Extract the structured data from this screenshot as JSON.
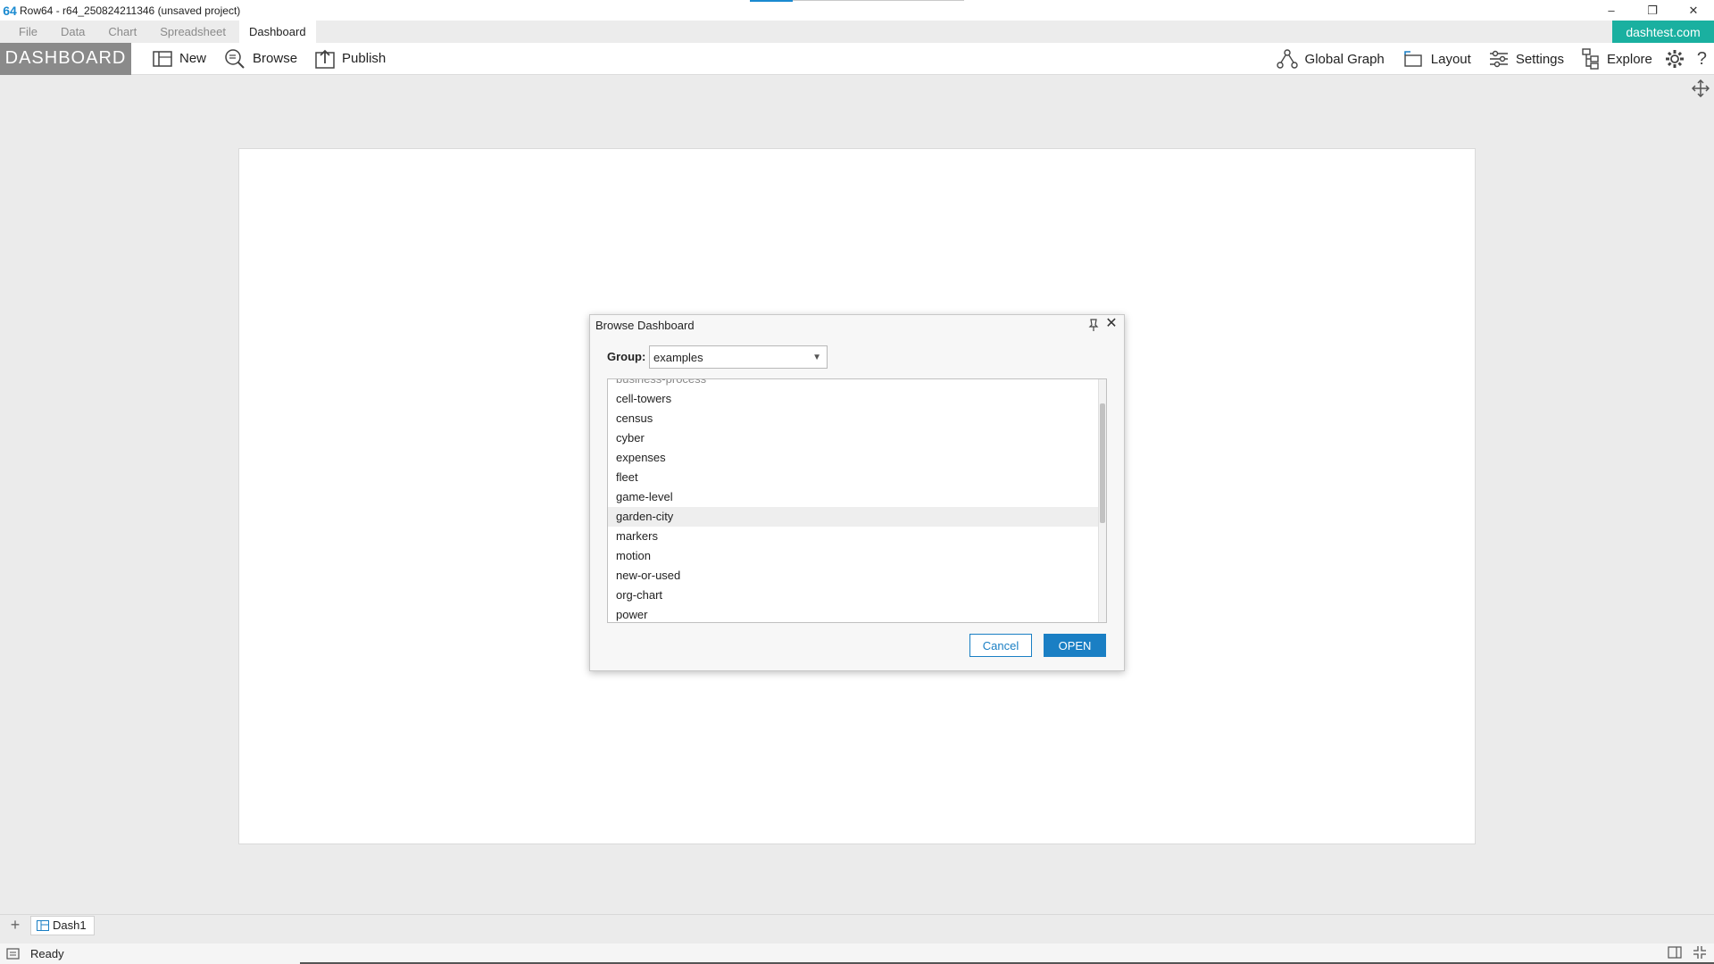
{
  "titlebar": {
    "logo": "64",
    "title": "Row64 - r64_250824211346 (unsaved project)",
    "minimize": "–",
    "restore": "❐",
    "close": "✕"
  },
  "menu": {
    "tabs": [
      "File",
      "Data",
      "Chart",
      "Spreadsheet",
      "Dashboard"
    ],
    "active": "Dashboard",
    "site_badge": "dashtest.com"
  },
  "toolbar": {
    "section_label": "DASHBOARD",
    "new_label": "New",
    "browse_label": "Browse",
    "publish_label": "Publish",
    "global_graph_label": "Global Graph",
    "layout_label": "Layout",
    "settings_label": "Settings",
    "explore_label": "Explore",
    "help_glyph": "?"
  },
  "dialog": {
    "title": "Browse Dashboard",
    "close_glyph": "✕",
    "group_label": "Group:",
    "group_value": "examples",
    "items": [
      "business-process",
      "cell-towers",
      "census",
      "cyber",
      "expenses",
      "fleet",
      "game-level",
      "garden-city",
      "markers",
      "motion",
      "new-or-used",
      "org-chart",
      "power"
    ],
    "hovered_item": "garden-city",
    "cancel_label": "Cancel",
    "open_label": "OPEN"
  },
  "tabs": {
    "add_glyph": "+",
    "sheet_name": "Dash1"
  },
  "status": {
    "text": "Ready"
  },
  "colors": {
    "accent": "#1a7fc4",
    "badge": "#1ab0a0",
    "section_label_bg": "#8a8a8a"
  }
}
